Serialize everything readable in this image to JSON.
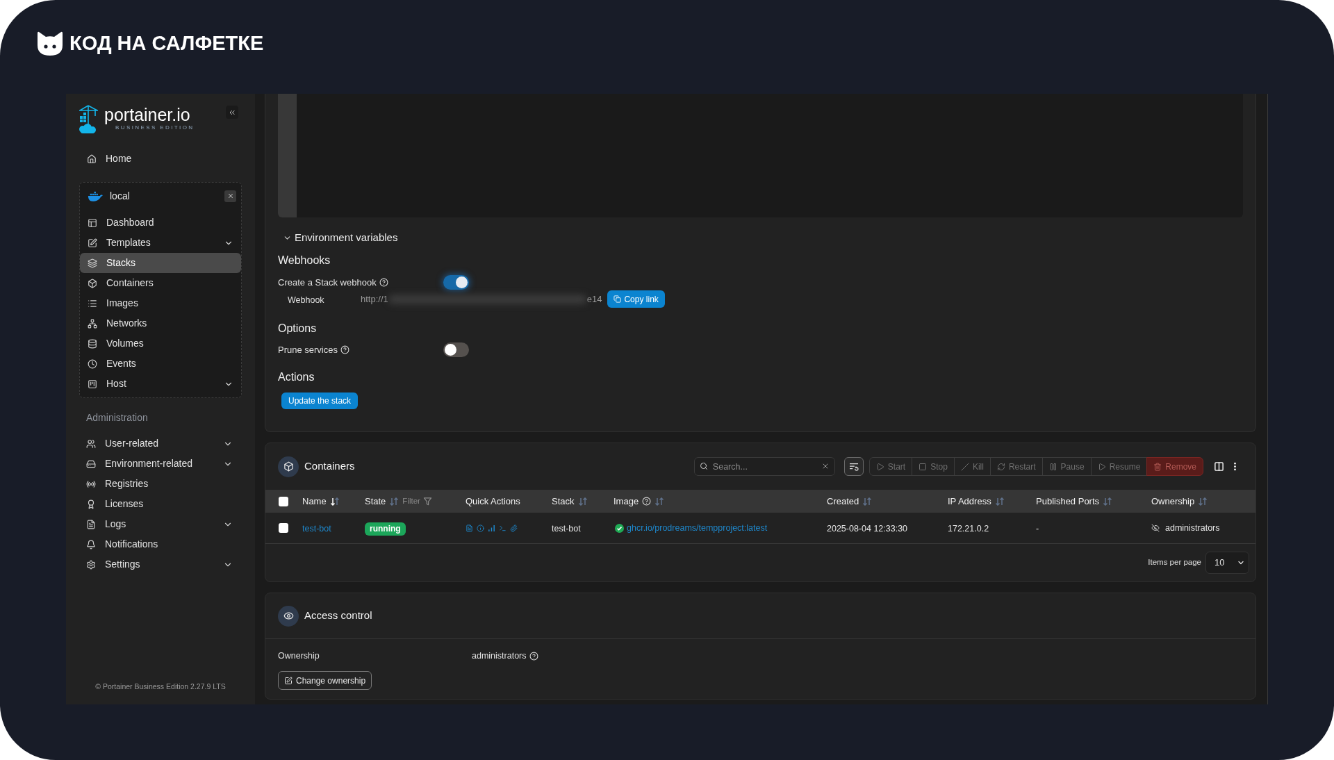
{
  "brand": {
    "title": "КОД НА САЛФЕТКЕ"
  },
  "sidebar": {
    "logo": {
      "name": "portainer.io",
      "edition": "BUSINESS EDITION"
    },
    "home": {
      "label": "Home",
      "selected": false
    },
    "environment": {
      "name": "local",
      "items": [
        {
          "label": "Dashboard",
          "selected": false,
          "submenu": false
        },
        {
          "label": "Templates",
          "selected": false,
          "submenu": true
        },
        {
          "label": "Stacks",
          "selected": true,
          "submenu": false
        },
        {
          "label": "Containers",
          "selected": false,
          "submenu": false
        },
        {
          "label": "Images",
          "selected": false,
          "submenu": false
        },
        {
          "label": "Networks",
          "selected": false,
          "submenu": false
        },
        {
          "label": "Volumes",
          "selected": false,
          "submenu": false
        },
        {
          "label": "Events",
          "selected": false,
          "submenu": false
        },
        {
          "label": "Host",
          "selected": false,
          "submenu": true
        }
      ]
    },
    "admin": {
      "heading": "Administration",
      "items": [
        {
          "label": "User-related",
          "selected": false,
          "submenu": true
        },
        {
          "label": "Environment-related",
          "selected": false,
          "submenu": true
        },
        {
          "label": "Registries",
          "selected": false,
          "submenu": false
        },
        {
          "label": "Licenses",
          "selected": false,
          "submenu": false
        },
        {
          "label": "Logs",
          "selected": false,
          "submenu": true
        },
        {
          "label": "Notifications",
          "selected": false,
          "submenu": false
        },
        {
          "label": "Settings",
          "selected": false,
          "submenu": true
        }
      ]
    },
    "footer": "© Portainer Business Edition 2.27.9 LTS"
  },
  "stack_form": {
    "env_vars": "Environment variables",
    "webhooks": {
      "heading": "Webhooks",
      "toggle_label": "Create a Stack webhook",
      "on": true,
      "webhook_label": "Webhook",
      "url_start": "http://1",
      "url_end": "e14",
      "copy_button": "Copy link"
    },
    "options": {
      "heading": "Options",
      "prune_label": "Prune services",
      "on": false
    },
    "actions": {
      "heading": "Actions",
      "button": "Update the stack"
    }
  },
  "containers": {
    "title": "Containers",
    "search": {
      "placeholder": "Search..."
    },
    "actions": [
      {
        "label": "Start",
        "kind": "default",
        "disabled": true
      },
      {
        "label": "Stop",
        "kind": "default",
        "disabled": true
      },
      {
        "label": "Kill",
        "kind": "default",
        "disabled": true
      },
      {
        "label": "Restart",
        "kind": "default",
        "disabled": true
      },
      {
        "label": "Pause",
        "kind": "default",
        "disabled": true
      },
      {
        "label": "Resume",
        "kind": "default",
        "disabled": true
      },
      {
        "label": "Remove",
        "kind": "danger",
        "disabled": true
      }
    ],
    "select_all": {
      "checked": false
    },
    "columns": [
      {
        "label": "Name",
        "sortable": true,
        "sorted": true,
        "help": false
      },
      {
        "label": "State",
        "sortable": true,
        "sorted": false,
        "help": false,
        "filter": "Filter"
      },
      {
        "label": "Quick Actions",
        "sortable": false,
        "help": false
      },
      {
        "label": "Stack",
        "sortable": true,
        "sorted": false,
        "help": false
      },
      {
        "label": "Image",
        "sortable": true,
        "sorted": false,
        "help": true
      },
      {
        "label": "Created",
        "sortable": true,
        "sorted": false,
        "help": false
      },
      {
        "label": "IP Address",
        "sortable": true,
        "sorted": false,
        "help": false
      },
      {
        "label": "Published Ports",
        "sortable": true,
        "sorted": false,
        "help": false
      },
      {
        "label": "Ownership",
        "sortable": true,
        "sorted": false,
        "help": false
      }
    ],
    "rows": [
      {
        "checked": false,
        "name": "test-bot",
        "state": "running",
        "stack": "test-bot",
        "image": "ghcr.io/prodreams/tempproject:latest",
        "created": "2025-08-04 12:33:30",
        "ip_address": "172.21.0.2",
        "published_ports": "-",
        "ownership": "administrators"
      }
    ],
    "pagination": {
      "label": "Items per page",
      "value": "10"
    }
  },
  "access_control": {
    "title": "Access control",
    "ownership_label": "Ownership",
    "ownership_value": "administrators",
    "button": "Change ownership"
  }
}
